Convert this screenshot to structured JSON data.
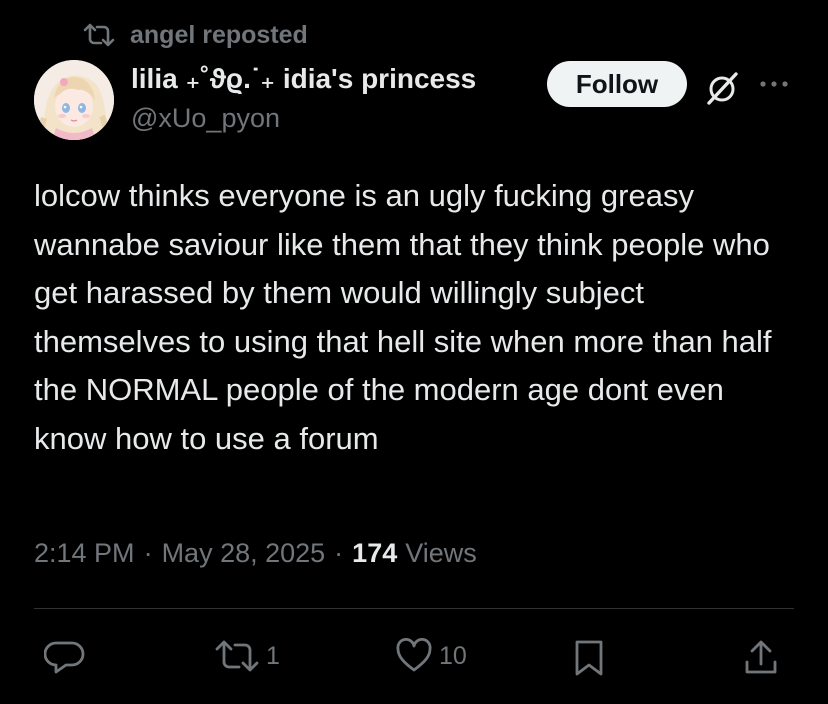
{
  "repost": {
    "icon": "repost-icon",
    "label": "angel reposted"
  },
  "author": {
    "display_name": "lilia ₊˚ϑϱ.˙₊ idia's princess",
    "handle": "@xUo_pyon",
    "avatar": "anime-avatar"
  },
  "header_actions": {
    "follow_label": "Follow",
    "grok_icon": "grok-icon",
    "more_icon": "more-icon"
  },
  "tweet": {
    "text": "lolcow thinks everyone is an ugly fucking greasy wannabe saviour like them that they think people who get harassed by them would willingly subject themselves to using that hell site when more than half the NORMAL people of the modern age dont even know how to use a forum",
    "time": "2:14 PM",
    "date": "May 28, 2025",
    "views_count": "174",
    "views_label": "Views",
    "separator": "·"
  },
  "actions": {
    "reply_icon": "reply-icon",
    "repost_icon": "repost-icon",
    "repost_count": "1",
    "like_icon": "heart-icon",
    "like_count": "10",
    "bookmark_icon": "bookmark-icon",
    "share_icon": "share-icon"
  },
  "colors": {
    "background": "#000000",
    "primary_text": "#e7e9ea",
    "secondary_text": "#71767b",
    "divider": "#2f3336",
    "follow_bg": "#eff3f4"
  }
}
